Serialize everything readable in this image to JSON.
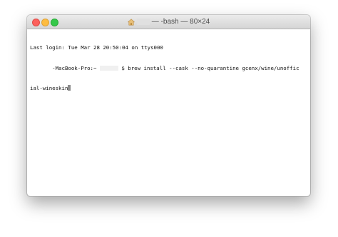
{
  "window": {
    "title_suffix": "— -bash — 80×24",
    "home_icon": "home-folder-icon"
  },
  "terminal": {
    "last_login": "Last login: Tue Mar 28 20:50:04 on ttys000",
    "prompt_host": "-MacBook-Pro:~",
    "command_part1": "$ brew install --cask --no-quarantine gcenx/wine/unoffic",
    "command_part2": "ial-wineskin"
  },
  "colors": {
    "close": "#fc605c",
    "minimize": "#fdbc40",
    "zoom": "#34c84a"
  }
}
